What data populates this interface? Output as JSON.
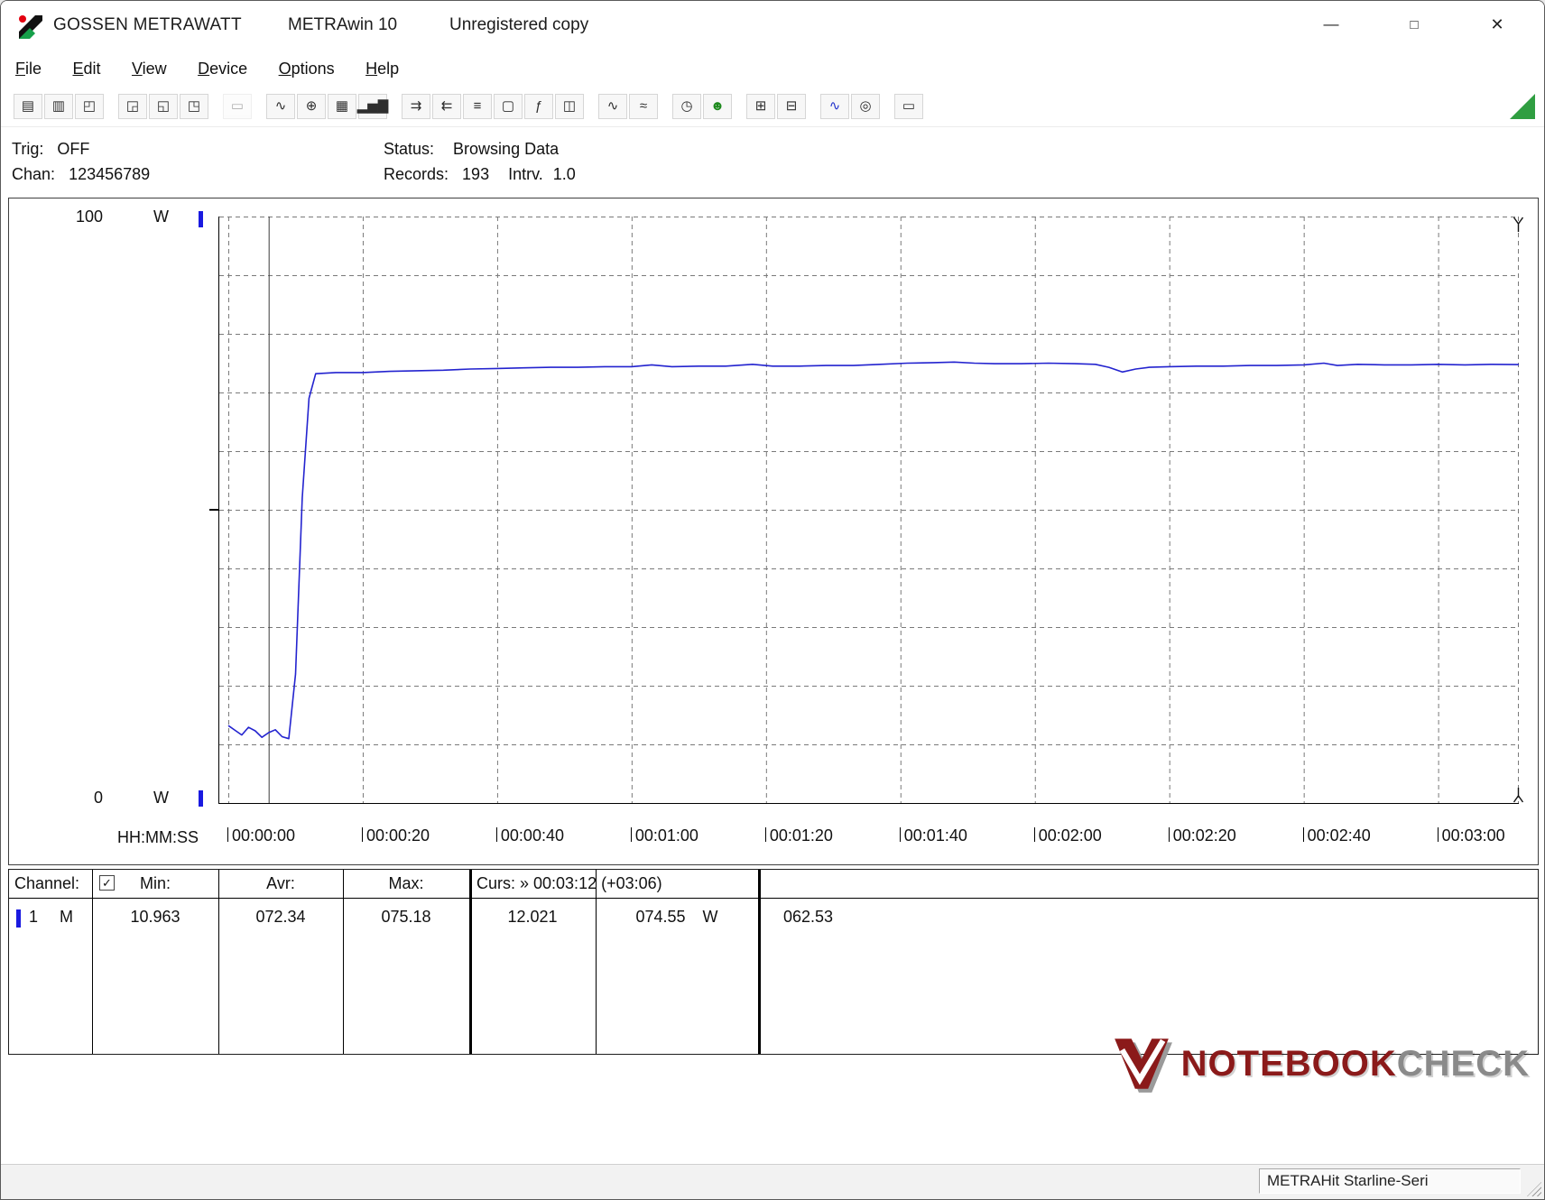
{
  "titlebar": {
    "brand": "GOSSEN METRAWATT",
    "app": "METRAwin 10",
    "license": "Unregistered copy"
  },
  "window_controls": {
    "minimize": "—",
    "maximize": "□",
    "close": "✕"
  },
  "menu": {
    "items": [
      "File",
      "Edit",
      "View",
      "Device",
      "Options",
      "Help"
    ]
  },
  "toolbar": {
    "buttons": [
      {
        "name": "save",
        "glyph": "▤"
      },
      {
        "name": "save-as",
        "glyph": "▥"
      },
      {
        "name": "open",
        "glyph": "◰"
      },
      {
        "name": "device-settings",
        "glyph": "◲",
        "gap": true
      },
      {
        "name": "device-store",
        "glyph": "◱"
      },
      {
        "name": "device-memory",
        "glyph": "◳"
      },
      {
        "name": "modem",
        "glyph": "▭",
        "gap": true,
        "disabled": true
      },
      {
        "name": "curve-view",
        "glyph": "∿",
        "gap": true
      },
      {
        "name": "scope-view",
        "glyph": "⊕"
      },
      {
        "name": "table-view",
        "glyph": "▦"
      },
      {
        "name": "bargraph-view",
        "glyph": "▂▅▇"
      },
      {
        "name": "export-data",
        "glyph": "⇉",
        "gap": true
      },
      {
        "name": "import-data",
        "glyph": "⇇"
      },
      {
        "name": "channel-list",
        "glyph": "≡"
      },
      {
        "name": "monitor-view",
        "glyph": "▢"
      },
      {
        "name": "formula",
        "glyph": "ƒ"
      },
      {
        "name": "display-view",
        "glyph": "◫"
      },
      {
        "name": "waveform-a",
        "glyph": "∿",
        "gap": true
      },
      {
        "name": "waveform-b",
        "glyph": "≈"
      },
      {
        "name": "time-setup",
        "glyph": "◷",
        "gap": true
      },
      {
        "name": "live-mode",
        "glyph": "☻",
        "color": "#1d8a1d"
      },
      {
        "name": "print-preview",
        "glyph": "⊞",
        "gap": true
      },
      {
        "name": "print",
        "glyph": "⊟"
      },
      {
        "name": "zoom-curve",
        "glyph": "∿",
        "color": "#2233cc",
        "gap": true
      },
      {
        "name": "zoom-search",
        "glyph": "◎"
      },
      {
        "name": "tooltip-mode",
        "glyph": "▭",
        "gap": true
      }
    ]
  },
  "info": {
    "trig_label": "Trig:",
    "trig_value": "OFF",
    "chan_label": "Chan:",
    "chan_value": "123456789",
    "status_label": "Status:",
    "status_value": "Browsing Data",
    "records_label": "Records:",
    "records_value": "193",
    "intrv_label": "Intrv.",
    "intrv_value": "1.0"
  },
  "chart": {
    "y_max": "100",
    "y_min": "0",
    "y_unit": "W",
    "x_axis_label": "HH:MM:SS"
  },
  "chart_data": {
    "type": "line",
    "title": "",
    "ylabel": "W",
    "xlabel": "HH:MM:SS",
    "ylim": [
      0,
      100
    ],
    "xlim_s": [
      0,
      192
    ],
    "grid": "dashed",
    "x_ticks_s": [
      0,
      20,
      40,
      60,
      80,
      100,
      120,
      140,
      160,
      180
    ],
    "x_tick_labels": [
      "00:00:00",
      "00:00:20",
      "00:00:40",
      "00:01:00",
      "00:01:20",
      "00:01:40",
      "00:02:00",
      "00:02:20",
      "00:02:40",
      "00:03:00"
    ],
    "series": [
      {
        "name": "Channel 1 (M) power W",
        "points": [
          [
            0,
            13.2
          ],
          [
            1,
            12.4
          ],
          [
            2,
            11.6
          ],
          [
            3,
            12.9
          ],
          [
            4,
            12.3
          ],
          [
            5,
            11.2
          ],
          [
            6,
            12.0
          ],
          [
            7,
            12.5
          ],
          [
            8,
            11.3
          ],
          [
            9,
            10.963
          ],
          [
            10,
            22.0
          ],
          [
            11,
            52.0
          ],
          [
            12,
            69.0
          ],
          [
            13,
            73.2
          ],
          [
            16,
            73.4
          ],
          [
            20,
            73.4
          ],
          [
            24,
            73.6
          ],
          [
            28,
            73.7
          ],
          [
            32,
            73.8
          ],
          [
            36,
            74.0
          ],
          [
            40,
            74.1
          ],
          [
            44,
            74.2
          ],
          [
            48,
            74.3
          ],
          [
            52,
            74.3
          ],
          [
            56,
            74.4
          ],
          [
            60,
            74.4
          ],
          [
            63,
            74.7
          ],
          [
            66,
            74.4
          ],
          [
            70,
            74.5
          ],
          [
            74,
            74.5
          ],
          [
            78,
            74.8
          ],
          [
            81,
            74.5
          ],
          [
            85,
            74.5
          ],
          [
            89,
            74.6
          ],
          [
            93,
            74.6
          ],
          [
            97,
            74.8
          ],
          [
            101,
            75.0
          ],
          [
            105,
            75.1
          ],
          [
            108,
            75.18
          ],
          [
            111,
            75.0
          ],
          [
            114,
            74.9
          ],
          [
            118,
            74.9
          ],
          [
            122,
            75.0
          ],
          [
            126,
            74.9
          ],
          [
            129,
            74.8
          ],
          [
            131,
            74.3
          ],
          [
            133,
            73.5
          ],
          [
            135,
            74.0
          ],
          [
            137,
            74.3
          ],
          [
            140,
            74.4
          ],
          [
            144,
            74.5
          ],
          [
            148,
            74.5
          ],
          [
            152,
            74.6
          ],
          [
            156,
            74.6
          ],
          [
            160,
            74.7
          ],
          [
            163,
            75.0
          ],
          [
            165,
            74.6
          ],
          [
            168,
            74.8
          ],
          [
            172,
            74.7
          ],
          [
            176,
            74.7
          ],
          [
            180,
            74.8
          ],
          [
            184,
            74.7
          ],
          [
            188,
            74.8
          ],
          [
            192,
            74.75
          ]
        ]
      }
    ],
    "cursors": [
      {
        "time_s": 6,
        "value_w": 12.021
      },
      {
        "time_s": 192,
        "value_w": 74.55
      }
    ],
    "stats": {
      "min": 10.963,
      "avg": 72.34,
      "max": 75.18,
      "cursor_delta": 62.53
    }
  },
  "table": {
    "header": {
      "channel": "Channel:",
      "min": "Min:",
      "avr": "Avr:",
      "max": "Max:",
      "cursor": "Curs: » 00:03:12 (+03:06)"
    },
    "row": {
      "channel": "1",
      "mode": "M",
      "min": "10.963",
      "avr": "072.34",
      "max": "075.18",
      "cursor1": "12.021",
      "cursor2": "074.55",
      "cursor2_unit": "W",
      "delta": "062.53"
    }
  },
  "icons": {
    "checkbox_check": "✓"
  },
  "watermark": {
    "word1": "NOTEBOOK",
    "word2": "CHECK"
  },
  "statusbar": {
    "device": "METRAHit Starline-Seri"
  },
  "colors": {
    "chart_line": "#2323cf",
    "channel_marker": "#1a1ae0",
    "toolbar_triangle": "#2f9e41",
    "watermark_red": "#8b1a1a",
    "watermark_gray": "#8a8a8a"
  }
}
